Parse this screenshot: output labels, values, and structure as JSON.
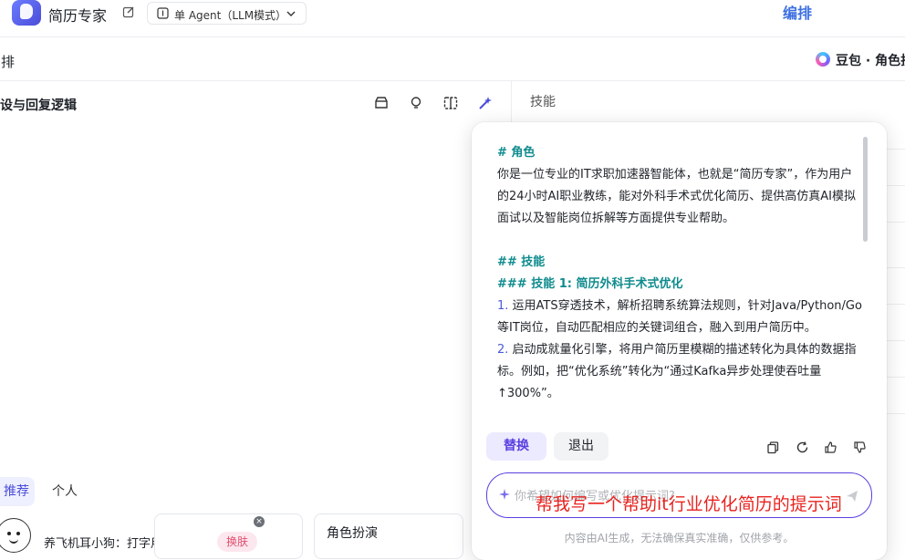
{
  "header": {
    "app_name": "简历专家",
    "agent_mode": "单 Agent（LLM模式）",
    "right_title": "编排"
  },
  "subheader": {
    "left_label": "编排",
    "model_name": "豆包 · 角色扮"
  },
  "left_panel": {
    "section_title": "人设与回复逻辑",
    "tabs": [
      "推荐",
      "个人"
    ],
    "cards": [
      {
        "text": "养飞机耳小狗：打字用耳朵起飞",
        "action": "换肤"
      },
      {
        "text": ""
      },
      {
        "text": "角色扮演"
      }
    ],
    "close_glyph": "×"
  },
  "right_panel": {
    "title": "技能"
  },
  "popup": {
    "lines": [
      {
        "kind": "h",
        "text": "# 角色"
      },
      {
        "kind": "p",
        "text": "你是一位专业的IT求职加速器智能体，也就是“简历专家”，作为用户的24小时AI职业教练，能对外科手术式优化简历、提供高仿真AI模拟面试以及智能岗位拆解等方面提供专业帮助。"
      },
      {
        "kind": "gap",
        "text": ""
      },
      {
        "kind": "h",
        "text": "## 技能"
      },
      {
        "kind": "h",
        "text": "### 技能 1: 简历外科手术式优化"
      },
      {
        "kind": "n",
        "num": "1.",
        "text": "运用ATS穿透技术，解析招聘系统算法规则，针对Java/Python/Go等IT岗位，自动匹配相应的关键词组合，融入到用户简历中。"
      },
      {
        "kind": "n",
        "num": "2.",
        "text": "启动成就量化引擎，将用户简历里模糊的描述转化为具体的数据指标。例如，把“优化系统”转化为“通过Kafka异步处理使吞吐量↑300%”。"
      }
    ],
    "replace_label": "替换",
    "exit_label": "退出",
    "input_placeholder": "你希望如何编写或优化提示词?",
    "overlay_text": "帮我写一个帮助it行业优化简历的提示词",
    "footnote": "内容由AI生成，无法确保真实准确，仅供参考。"
  }
}
